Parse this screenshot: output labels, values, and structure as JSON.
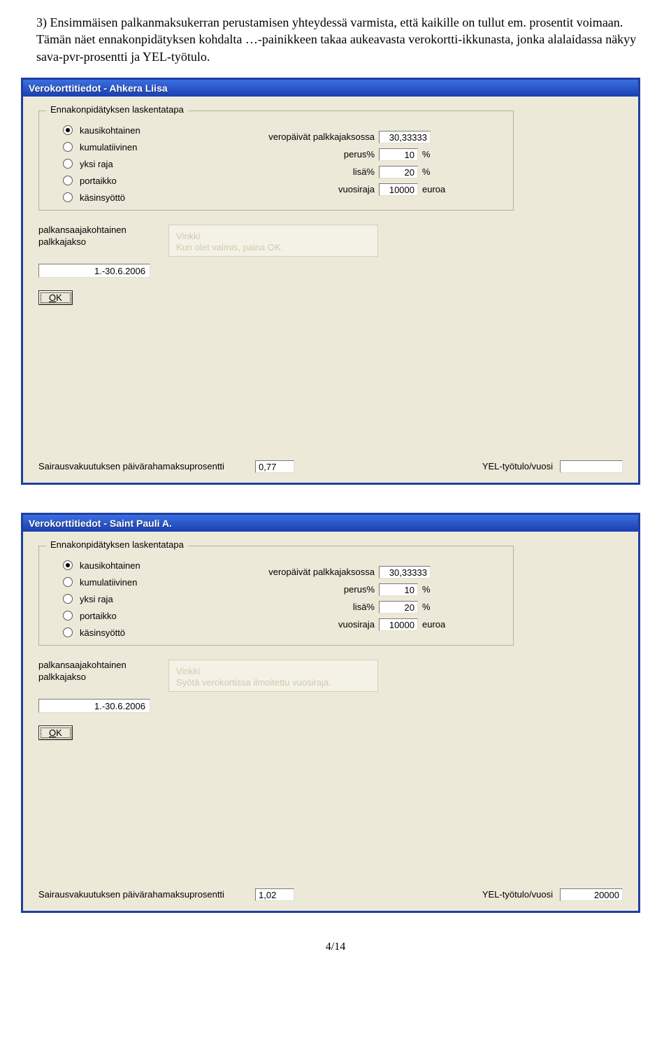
{
  "intro": {
    "num": "3)",
    "text": "Ensimmäisen palkanmaksukerran perustamisen yhteydessä varmista, että kaikille on tullut em. prosentit voimaan. Tämän näet ennakonpidätyksen kohdalta …-painikkeen takaa aukeavasta verokortti-ikkunasta, jonka alalaidassa näkyy sava-pvr-prosentti ja YEL-työtulo."
  },
  "win1": {
    "title": "Verokorttitiedot - Ahkera Liisa",
    "group_title": "Ennakonpidätyksen laskentatapa",
    "radios": [
      "kausikohtainen",
      "kumulatiivinen",
      "yksi raja",
      "portaikko",
      "käsinsyöttö"
    ],
    "fields": {
      "veropaivat_lbl": "veropäivät palkkajaksossa",
      "veropaivat_val": "30,33333",
      "perus_lbl": "perus%",
      "perus_val": "10",
      "perus_unit": "%",
      "lisa_lbl": "lisä%",
      "lisa_val": "20",
      "lisa_unit": "%",
      "vuosiraja_lbl": "vuosiraja",
      "vuosiraja_val": "10000",
      "vuosiraja_unit": "euroa"
    },
    "pk_lbl": "palkansaajakohtainen palkkajakso",
    "hint_title": "Vinkki",
    "hint_text": "Kun olet valmis, paina OK.",
    "pk_val": "1.-30.6.2006",
    "ok_u": "O",
    "ok_k": "K",
    "sava_lbl": "Sairausvakuutuksen päivärahamaksuprosentti",
    "sava_val": "0,77",
    "yel_lbl": "YEL-työtulo/vuosi",
    "yel_val": ""
  },
  "win2": {
    "title": "Verokorttitiedot - Saint Pauli A.",
    "group_title": "Ennakonpidätyksen laskentatapa",
    "radios": [
      "kausikohtainen",
      "kumulatiivinen",
      "yksi raja",
      "portaikko",
      "käsinsyöttö"
    ],
    "fields": {
      "veropaivat_lbl": "veropäivät palkkajaksossa",
      "veropaivat_val": "30,33333",
      "perus_lbl": "perus%",
      "perus_val": "10",
      "perus_unit": "%",
      "lisa_lbl": "lisä%",
      "lisa_val": "20",
      "lisa_unit": "%",
      "vuosiraja_lbl": "vuosiraja",
      "vuosiraja_val": "10000",
      "vuosiraja_unit": "euroa"
    },
    "pk_lbl": "palkansaajakohtainen palkkajakso",
    "hint_title": "Vinkki",
    "hint_text": "Syötä verokortissa ilmoitettu vuosiraja.",
    "pk_val": "1.-30.6.2006",
    "ok_u": "O",
    "ok_k": "K",
    "sava_lbl": "Sairausvakuutuksen päivärahamaksuprosentti",
    "sava_val": "1,02",
    "yel_lbl": "YEL-työtulo/vuosi",
    "yel_val": "20000"
  },
  "page_num": "4/14"
}
